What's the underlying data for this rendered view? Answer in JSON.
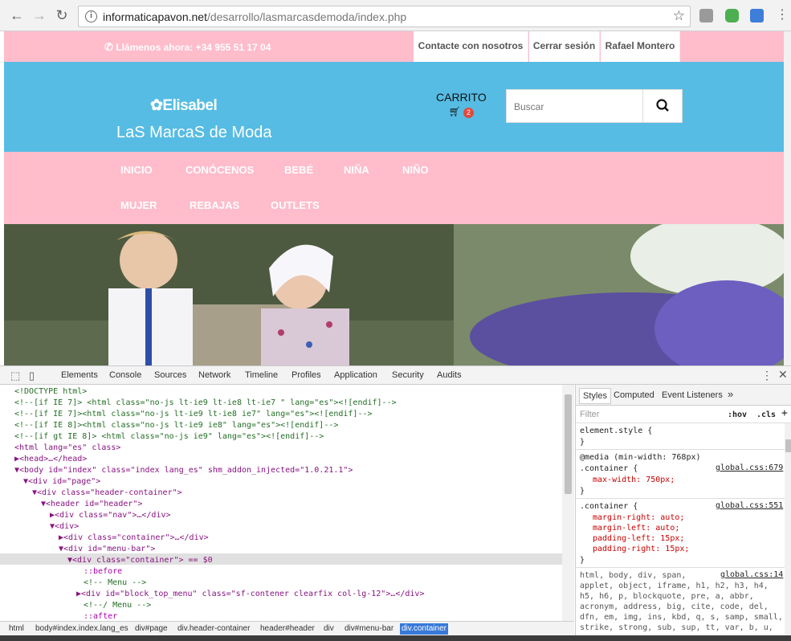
{
  "browser": {
    "url_domain": "informaticapavon.net",
    "url_path": "/desarrollo/lasmarcasdemoda/index.php",
    "info_icon": "info-icon",
    "bookmark_icon": "star-icon"
  },
  "site": {
    "phone": "Llámenos ahora: +34 955 51 17 04",
    "top_links": [
      "Contacte con nosotros",
      "Cerrar sesión",
      "Rafael Montero"
    ],
    "logo_brand": "Elisabel",
    "logo_tagline": "LaS MarcaS de Moda",
    "cart_label": "CARRITO",
    "cart_count": "2",
    "search_placeholder": "Buscar",
    "menu": [
      "INICIO",
      "CONÓCENOS",
      "BEBÉ",
      "NIÑA",
      "NIÑO",
      "MUJER",
      "REBAJAS",
      "OUTLETS"
    ],
    "colors": {
      "pink": "#ffbccb",
      "blue": "#56bce3",
      "badge": "#e0493d"
    }
  },
  "devtools": {
    "tabs": [
      "Elements",
      "Console",
      "Sources",
      "Network",
      "Timeline",
      "Profiles",
      "Application",
      "Security",
      "Audits"
    ],
    "dom": [
      "<!DOCTYPE html>",
      "<!--[if IE 7]> <html class=\"no-js lt-ie9 lt-ie8 lt-ie7 \" lang=\"es\"><![endif]-->",
      "<!--[if IE 7]><html class=\"no-js lt-ie9 lt-ie8 ie7\" lang=\"es\"><![endif]-->",
      "<!--[if IE 8]><html class=\"no-js lt-ie9 ie8\" lang=\"es\"><![endif]-->",
      "<!--[if gt IE 8]> <html class=\"no-js ie9\" lang=\"es\"><![endif]-->",
      "<html lang=\"es\" class>",
      "▶<head>…</head>",
      "▼<body id=\"index\" class=\"index lang_es\" shm_addon_injected=\"1.0.21.1\">",
      "▼<div id=\"page\">",
      "▼<div class=\"header-container\">",
      "▼<header id=\"header\">",
      "▶<div class=\"nav\">…</div>",
      "▼<div>",
      "▶<div class=\"container\">…</div>",
      "▼<div id=\"menu-bar\">",
      "▼<div class=\"container\"> == $0",
      "::before",
      "<!-- Menu -->",
      "▶<div id=\"block_top_menu\" class=\"sf-contener clearfix col-lg-12\">…</div>",
      "<!--/ Menu -->",
      "::after"
    ],
    "breadcrumbs": [
      "html",
      "body#index.index.lang_es",
      "div#page",
      "div.header-container",
      "header#header",
      "div",
      "div#menu-bar",
      "div.container"
    ],
    "styles_tabs": [
      "Styles",
      "Computed",
      "Event Listeners"
    ],
    "filter_placeholder": "Filter",
    "hov": ":hov",
    "cls": ".cls",
    "rules": {
      "element_style": "element.style {",
      "close": "}",
      "media": "@media (min-width: 768px)",
      "container_sel": ".container {",
      "r1_src": "global.css:679",
      "r1_prop": "max-width: 750px;",
      "r2_src": "global.css:551",
      "r2_props": [
        "margin-right: auto;",
        "margin-left: auto;",
        "padding-left: 15px;",
        "padding-right: 15px;"
      ],
      "r3_sel": "html, body, div, span,",
      "r3_src": "global.css:14",
      "r3_more": [
        "applet, object, iframe, h1, h2, h3, h4,",
        "h5, h6, p, blockquote, pre, a, abbr,",
        "acronym, address, big, cite, code, del,",
        "dfn, em, img, ins, kbd, q, s, samp, small,",
        "strike, strong, sub, sup, tt, var, b, u,"
      ]
    }
  }
}
